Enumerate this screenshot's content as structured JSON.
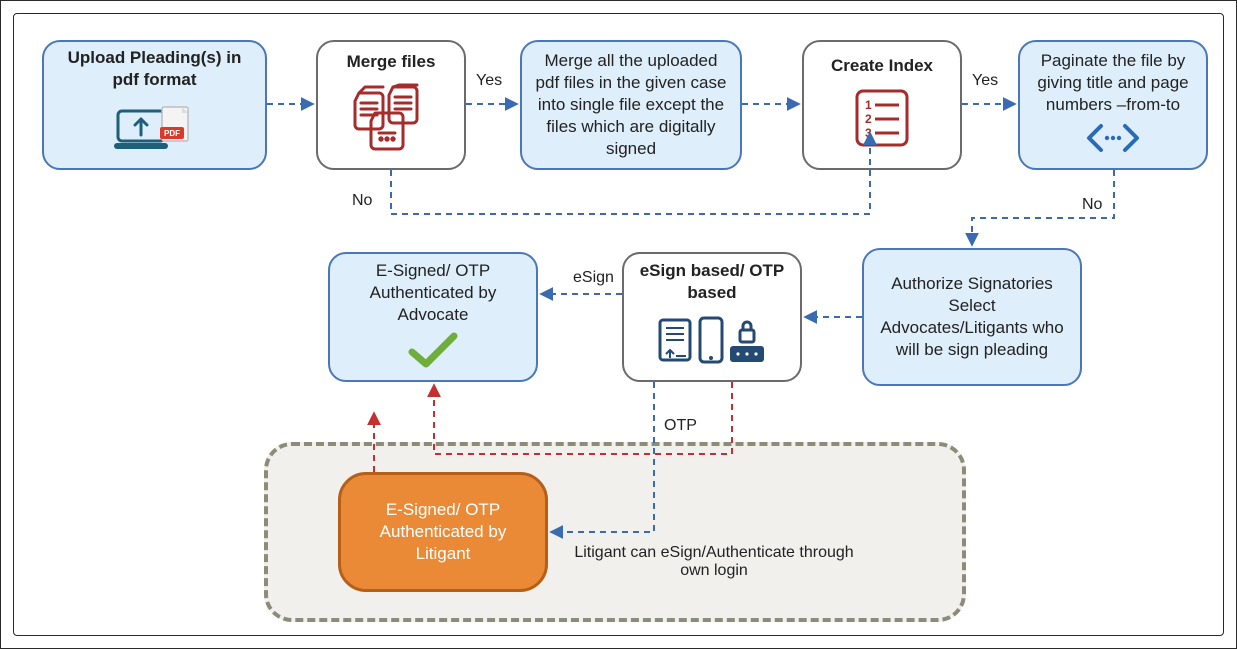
{
  "nodes": {
    "upload": {
      "title": "Upload Pleading(s) in pdf format"
    },
    "merge": {
      "title": "Merge files"
    },
    "mergeDesc": {
      "text": "Merge all the uploaded pdf files in the given case into single file except the files which are digitally signed"
    },
    "index": {
      "title": "Create Index"
    },
    "paginate": {
      "text": "Paginate the file by giving title and page numbers –from-to"
    },
    "authorize": {
      "text": "Authorize Signatories Select Advocates/Litigants who will be sign pleading"
    },
    "esign": {
      "title": "eSign based/ OTP based"
    },
    "advocate": {
      "text": "E-Signed/ OTP Authenticated by Advocate"
    },
    "litigant": {
      "text": "E-Signed/ OTP Authenticated by Litigant"
    }
  },
  "labels": {
    "yes1": "Yes",
    "no1": "No",
    "yes2": "Yes",
    "no2": "No",
    "esign": "eSign",
    "otp": "OTP",
    "zone": "Litigant can eSign/Authenticate through own login"
  },
  "icon_names": {
    "pdf": "PDF"
  }
}
